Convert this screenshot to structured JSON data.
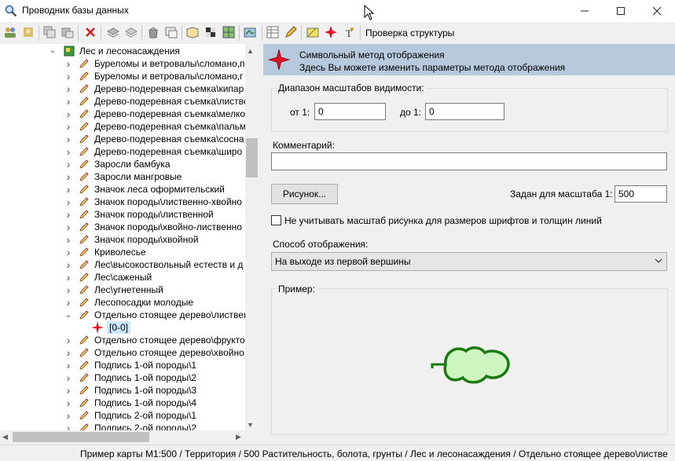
{
  "window": {
    "title": "Проводник базы данных",
    "controls": [
      "—",
      "☐",
      "✕"
    ]
  },
  "toolbar": {
    "check_structure": "Проверка структуры"
  },
  "tree": {
    "parent": "Лес и лесонасаждения",
    "items": [
      "Буреломы и ветровалы\\сломано,п",
      "Буреломы и ветровалы\\сломано,г",
      "Дерево-подеревная съемка\\кипар",
      "Дерево-подеревная съемка\\листве",
      "Дерево-подеревная съемка\\мелко",
      "Дерево-подеревная съемка\\пальм",
      "Дерево-подеревная съемка\\сосна",
      "Дерево-подеревная съемка\\широ",
      "Заросли бамбука",
      "Заросли мангровые",
      "Значок леса оформительский",
      "Значок породы\\лиственно-хвойно",
      "Значок породы\\лиственной",
      "Значок породы\\хвойно-лиственно",
      "Значок породы\\хвойной",
      "Криволесье",
      "Лес\\высокоствольный естеств и д",
      "Лес\\саженый",
      "Лес\\угнетенный",
      "Лесопосадки молодые",
      "Отдельно стоящее дерево\\листвен"
    ],
    "selected_child": "[0-0]",
    "items_after": [
      "Отдельно стоящее дерево\\фрукто",
      "Отдельно стоящее дерево\\хвойно",
      "Подпись 1-ой породы\\1",
      "Подпись 1-ой породы\\2",
      "Подпись 1-ой породы\\3",
      "Подпись 1-ой породы\\4",
      "Подпись 2-ой породы\\1",
      "Подпись 2-ой породы\\2"
    ]
  },
  "panel": {
    "header_title": "Символьный метод отображения",
    "header_subtitle": "Здесь Вы можете изменить параметры метода отображения",
    "range_group": "Диапазон масштабов видимости:",
    "from_label": "от 1:",
    "from_value": "0",
    "to_label": "до 1:",
    "to_value": "0",
    "comment_label": "Комментарий:",
    "comment_value": "",
    "picture_button": "Рисунок...",
    "scale_label": "Задан для масштаба 1:",
    "scale_value": "500",
    "ignore_scale_label": "Не учитывать масштаб рисунка для размеров шрифтов и толщин линий",
    "ignore_scale_checked": false,
    "display_mode_label": "Способ отображения:",
    "display_mode_value": "На выходе из первой вершины",
    "example_label": "Пример:"
  },
  "status": {
    "text": "Пример карты М1:500 / Территория / 500 Растительность, болота, грунты / Лес и лесонасаждения / Отдельно стоящее дерево\\листве"
  },
  "colors": {
    "header_bg": "#b7c9dc",
    "star_red": "#e81123",
    "tree_fill": "#ccf5c0",
    "tree_stroke": "#1a7a10"
  }
}
